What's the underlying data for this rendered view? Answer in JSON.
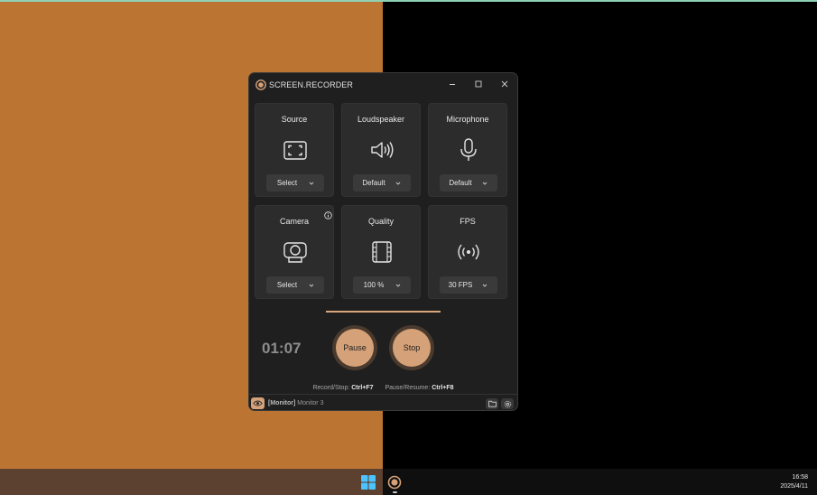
{
  "window": {
    "title": "SCREEN.RECORDER",
    "minimize_icon": "minimize-icon",
    "maximize_icon": "maximize-icon",
    "close_icon": "close-icon"
  },
  "cards": {
    "source": {
      "title": "Source",
      "icon": "screen-capture-icon",
      "value": "Select"
    },
    "loudspeaker": {
      "title": "Loudspeaker",
      "icon": "speaker-icon",
      "value": "Default"
    },
    "microphone": {
      "title": "Microphone",
      "icon": "microphone-icon",
      "value": "Default"
    },
    "camera": {
      "title": "Camera",
      "icon": "webcam-icon",
      "value": "Select"
    },
    "quality": {
      "title": "Quality",
      "icon": "film-frame-icon",
      "value": "100 %"
    },
    "fps": {
      "title": "FPS",
      "icon": "broadcast-icon",
      "value": "30 FPS"
    }
  },
  "recording": {
    "timer": "01:07",
    "pause_label": "Pause",
    "stop_label": "Stop"
  },
  "hotkeys": {
    "record_label": "Record/Stop:",
    "record_key": "Ctrl+F7",
    "pause_label": "Pause/Resume:",
    "pause_key": "Ctrl+F8"
  },
  "status": {
    "prefix": "[Monitor]",
    "monitor": "Monitor 3"
  },
  "taskbar": {
    "time": "16:58",
    "date": "2025/4/11"
  },
  "colors": {
    "accent": "#d5a178",
    "desktop_left": "#bc7433",
    "window_bg": "#1f1f1f",
    "card_bg": "#2c2c2c"
  }
}
